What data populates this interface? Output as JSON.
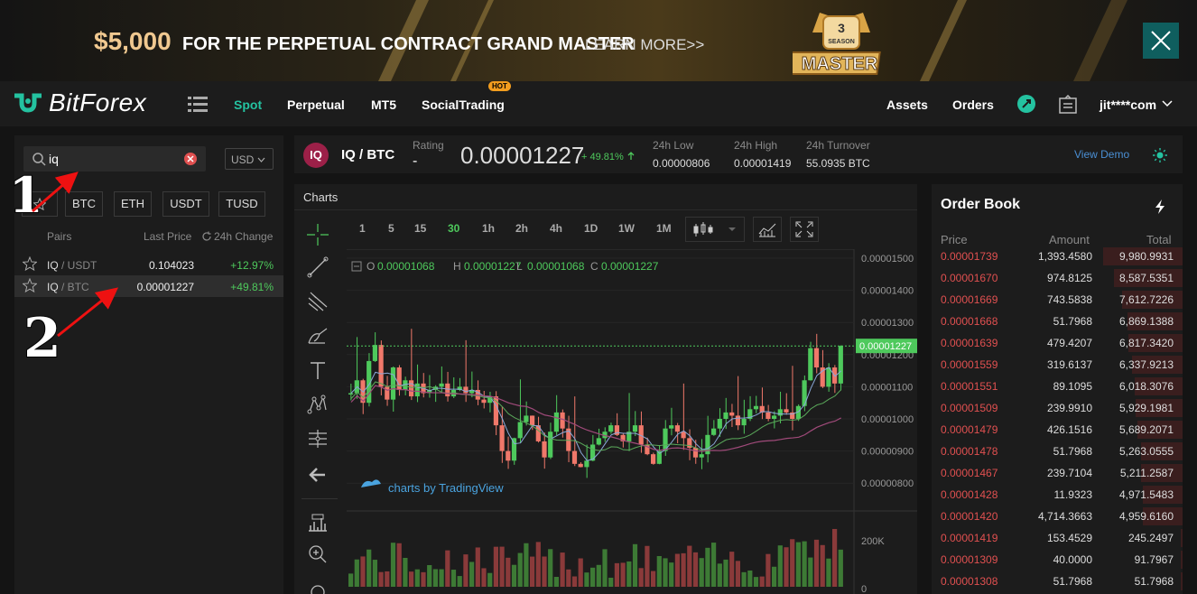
{
  "banner": {
    "amount": "$5,000",
    "desc": "FOR THE PERPETUAL CONTRACT GRAND MASTER",
    "learn": "LEARN MORE>>",
    "badge_num": "3",
    "badge_season": "SEASON",
    "badge_text": "MASTER"
  },
  "nav": {
    "logo": "BitForex",
    "items": [
      "Spot",
      "Perpetual",
      "MT5",
      "SocialTrading"
    ],
    "hot": "HOT",
    "assets": "Assets",
    "orders": "Orders",
    "user": "jit****com"
  },
  "search": {
    "value": "iq",
    "currency": "USD"
  },
  "quote_tabs": [
    "BTC",
    "ETH",
    "USDT",
    "TUSD"
  ],
  "list_head": {
    "pairs": "Pairs",
    "last": "Last Price",
    "change": "24h Change"
  },
  "pairs": [
    {
      "base": "IQ",
      "quote": "/ USDT",
      "price": "0.104023",
      "change": "+12.97%"
    },
    {
      "base": "IQ",
      "quote": "/ BTC",
      "price": "0.00001227",
      "change": "+49.81%"
    }
  ],
  "annotations": {
    "a1": "1",
    "a2": "2"
  },
  "ticker": {
    "coin": "IQ",
    "symbol": "IQ / BTC",
    "rating_label": "Rating",
    "rating": "-",
    "price": "0.00001227",
    "change": "+ 49.81%",
    "low_label": "24h Low",
    "low": "0.00000806",
    "high_label": "24h High",
    "high": "0.00001419",
    "turn_label": "24h Turnover",
    "turn": "55.0935 BTC",
    "demo": "View Demo"
  },
  "chart": {
    "title": "Charts",
    "timeframes": [
      "1",
      "5",
      "15",
      "30",
      "1h",
      "2h",
      "4h",
      "1D",
      "1W",
      "1M"
    ],
    "active_tf": "30",
    "ohlc": {
      "o": "0.00001068",
      "h": "0.00001227",
      "l": "0.00001068",
      "c": "0.00001227"
    },
    "price_ticks": [
      "0.00001500",
      "0.00001400",
      "0.00001300",
      "0.00001200",
      "0.00001100",
      "0.00001000",
      "0.00000900",
      "0.00000800"
    ],
    "last_price": "0.00001227",
    "vol_ticks": [
      "200K",
      "0"
    ],
    "watermark": "charts by TradingView"
  },
  "orderbook": {
    "title": "Order Book",
    "cols": [
      "Price",
      "Amount",
      "Total"
    ],
    "rows": [
      {
        "p": "0.00001739",
        "a": "1,393.4580",
        "t": "9,980.9931"
      },
      {
        "p": "0.00001670",
        "a": "974.8125",
        "t": "8,587.5351"
      },
      {
        "p": "0.00001669",
        "a": "743.5838",
        "t": "7,612.7226"
      },
      {
        "p": "0.00001668",
        "a": "51.7968",
        "t": "6,869.1388"
      },
      {
        "p": "0.00001639",
        "a": "479.4207",
        "t": "6,817.3420"
      },
      {
        "p": "0.00001559",
        "a": "319.6137",
        "t": "6,337.9213"
      },
      {
        "p": "0.00001551",
        "a": "89.1095",
        "t": "6,018.3076"
      },
      {
        "p": "0.00001509",
        "a": "239.9910",
        "t": "5,929.1981"
      },
      {
        "p": "0.00001479",
        "a": "426.1516",
        "t": "5,689.2071"
      },
      {
        "p": "0.00001478",
        "a": "51.7968",
        "t": "5,263.0555"
      },
      {
        "p": "0.00001467",
        "a": "239.7104",
        "t": "5,211.2587"
      },
      {
        "p": "0.00001428",
        "a": "11.9323",
        "t": "4,971.5483"
      },
      {
        "p": "0.00001420",
        "a": "4,714.3663",
        "t": "4,959.6160"
      },
      {
        "p": "0.00001419",
        "a": "153.4529",
        "t": "245.2497"
      },
      {
        "p": "0.00001309",
        "a": "40.0000",
        "t": "91.7967"
      },
      {
        "p": "0.00001308",
        "a": "51.7968",
        "t": "51.7968"
      }
    ]
  },
  "colors": {
    "up": "#4ec95c",
    "down": "#e05050",
    "accent": "#24c2a0"
  }
}
